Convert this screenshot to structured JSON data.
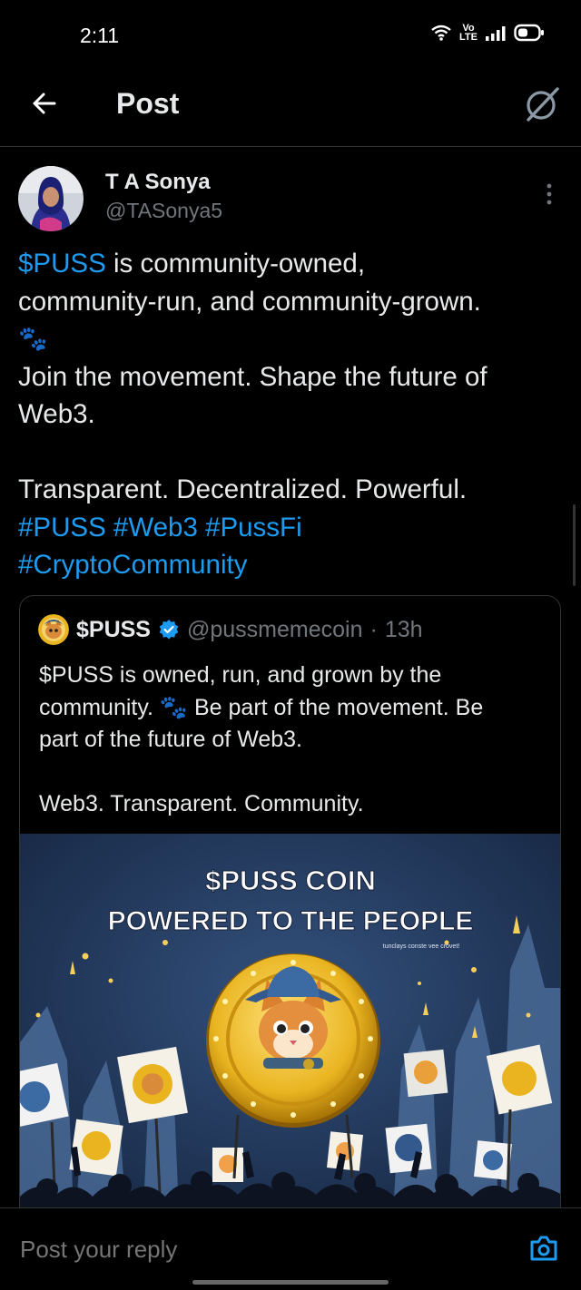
{
  "status_bar": {
    "time": "2:11",
    "volte_top": "Vo",
    "volte_bottom": "LTE",
    "icons": [
      "wifi-icon",
      "volte-icon",
      "signal-icon",
      "battery-icon"
    ]
  },
  "header": {
    "title": "Post",
    "back_icon": "arrow-left-icon",
    "grok_icon": "grok-icon"
  },
  "post": {
    "author": {
      "name": "T A Sonya",
      "handle": "@TASonya5"
    },
    "text": {
      "l1_link": "$PUSS",
      "l1_rest": " is community-owned,",
      "l2": "community-run, and community-grown.",
      "l3_emoji": "🐾",
      "l4": "Join the movement. Shape the future of",
      "l5": "Web3.",
      "l7": "Transparent. Decentralized. Powerful.",
      "l8": "#PUSS #Web3 #PussFi",
      "l9": "#CryptoCommunity"
    },
    "quote": {
      "name": "$PUSS",
      "handle": "@pussmemecoin",
      "separator": "·",
      "time": "13h",
      "l1": "$PUSS is owned, run, and grown by the",
      "l2a": "community. ",
      "l2_emoji": "🐾",
      "l2b": " Be part of the movement. Be",
      "l3": "part of the future of Web3.",
      "l5": "Web3. Transparent. Community.",
      "image": {
        "title_line1": "$PUSS COIN",
        "title_line2": "POWERED TO THE PEOPLE",
        "tagline": "tunclays conste vee crovet!",
        "colors": {
          "sky": "#233c63",
          "coin": "#e9b420",
          "accent": "#f5c542"
        }
      }
    }
  },
  "reply": {
    "placeholder": "Post your reply"
  },
  "colors": {
    "link": "#1d9bf0",
    "text": "#e7e9ea",
    "muted": "#71767b",
    "border": "#2f3336",
    "verified": "#1d9bf0"
  }
}
